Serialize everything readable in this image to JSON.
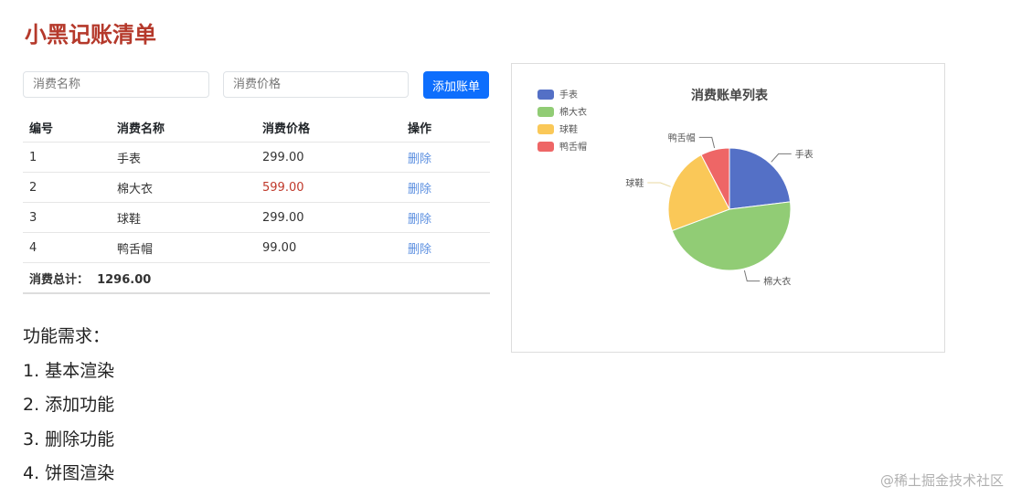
{
  "title": "小黑记账清单",
  "form": {
    "name_placeholder": "消费名称",
    "price_placeholder": "消费价格",
    "add_label": "添加账单"
  },
  "table": {
    "headers": [
      "编号",
      "消费名称",
      "消费价格",
      "操作"
    ],
    "rows": [
      {
        "id": "1",
        "name": "手表",
        "price": "299.00",
        "action": "删除"
      },
      {
        "id": "2",
        "name": "棉大衣",
        "price": "599.00",
        "action": "删除"
      },
      {
        "id": "3",
        "name": "球鞋",
        "price": "299.00",
        "action": "删除"
      },
      {
        "id": "4",
        "name": "鸭舌帽",
        "price": "99.00",
        "action": "删除"
      }
    ],
    "total_label": "消费总计：",
    "total_value": "1296.00"
  },
  "requirements": [
    "功能需求：",
    "1. 基本渲染",
    "2. 添加功能",
    "3. 删除功能",
    "4. 饼图渲染"
  ],
  "watermark": "@稀土掘金技术社区",
  "chart_data": {
    "type": "pie",
    "title": "消费账单列表",
    "categories": [
      "手表",
      "棉大衣",
      "球鞋",
      "鸭舌帽"
    ],
    "values": [
      299,
      599,
      299,
      99
    ],
    "colors": [
      "#5470c6",
      "#91cc75",
      "#fac858",
      "#ee6666"
    ],
    "legend": "top-left"
  }
}
